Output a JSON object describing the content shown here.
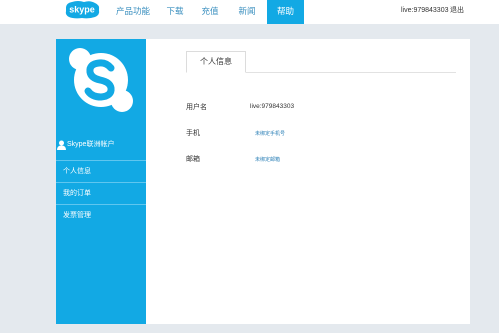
{
  "header": {
    "brand": "skype",
    "nav": [
      {
        "label": "产品功能",
        "active": false
      },
      {
        "label": "下载",
        "active": false
      },
      {
        "label": "充值",
        "active": false
      },
      {
        "label": "新闻",
        "active": false
      },
      {
        "label": "帮助",
        "active": true
      }
    ],
    "user_id": "live:979843303",
    "logout": "退出"
  },
  "sidebar": {
    "account_title": "Skype联洲帐户",
    "items": [
      {
        "label": "个人信息",
        "icon": "user-icon"
      },
      {
        "label": "我的订单"
      },
      {
        "label": "发票管理"
      }
    ]
  },
  "main": {
    "tab": "个人信息",
    "fields": [
      {
        "label": "用户名",
        "value": "live:979843303"
      },
      {
        "label": "手机",
        "link": "未绑定手机号"
      },
      {
        "label": "邮箱",
        "link": "未绑定邮箱"
      }
    ]
  },
  "colors": {
    "accent": "#12a9e4",
    "link": "#2a7fb6",
    "background": "#e4e9ee"
  }
}
